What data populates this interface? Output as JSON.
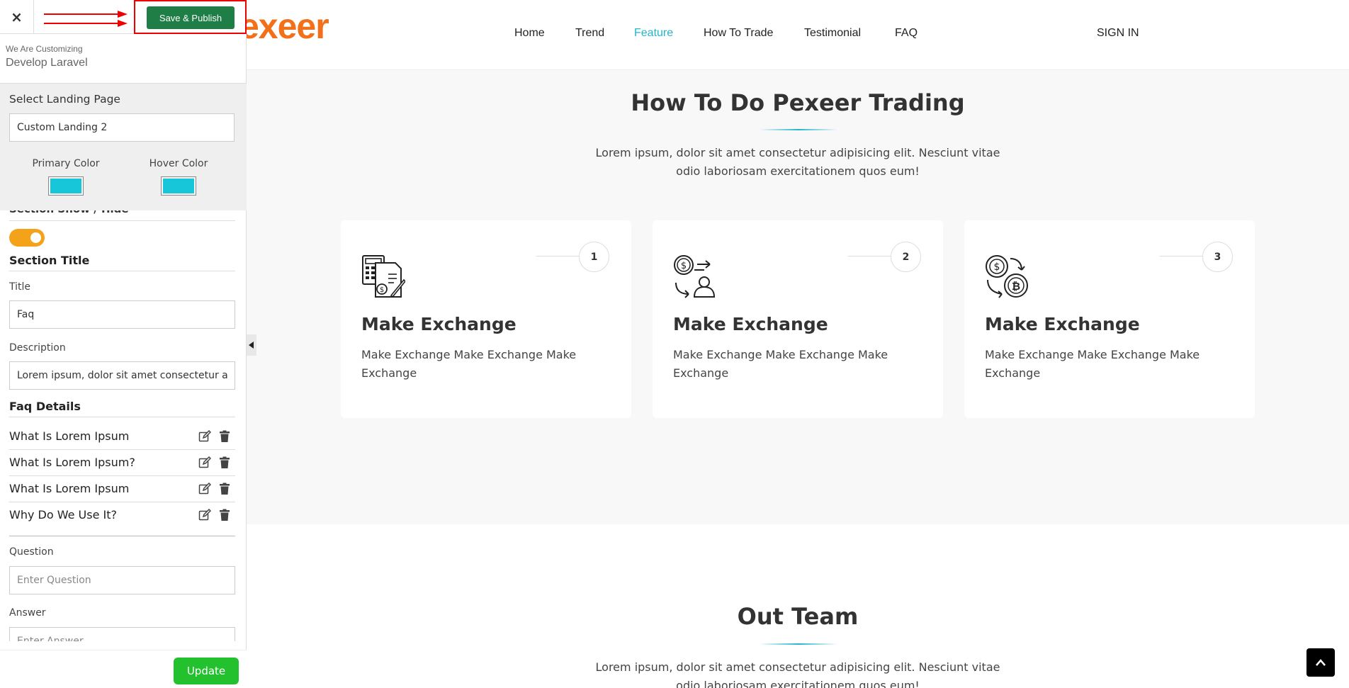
{
  "topbar": {
    "close_symbol": "×",
    "publish_label": "Save & Publish"
  },
  "customizing": {
    "small": "We Are Customizing",
    "name": "Develop Laravel"
  },
  "landing": {
    "label": "Select Landing Page",
    "value": "Custom Landing 2",
    "primary_color_label": "Primary Color",
    "hover_color_label": "Hover Color",
    "primary_color": "#17c6d8",
    "hover_color": "#17c6d8"
  },
  "section": {
    "show_hide_label": "Section Show / Hide",
    "toggle_on": true,
    "title_heading": "Section Title",
    "title_label": "Title",
    "title_value": "Faq",
    "description_label": "Description",
    "description_value": "Lorem ipsum, dolor sit amet consectetur adipisicing elit.",
    "faq_heading": "Faq Details",
    "faq_items": [
      "What Is Lorem Ipsum",
      "What Is Lorem Ipsum?",
      "What Is Lorem Ipsum",
      "Why Do We Use It?"
    ],
    "question_label": "Question",
    "question_placeholder": "Enter Question",
    "answer_label": "Answer",
    "answer_placeholder": "Enter Answer",
    "update_label": "Update"
  },
  "preview": {
    "logo_visible": "exeer",
    "nav": [
      "Home",
      "Trend",
      "Feature",
      "How To Trade",
      "Testimonial",
      "FAQ"
    ],
    "active_nav": "Feature",
    "signin": "SIGN IN",
    "accent_color": "#22b6cd",
    "logo_color": "#f3701a",
    "how_title": "How To Do Pexeer Trading",
    "how_desc": "Lorem ipsum, dolor sit amet consectetur adipisicing elit. Nesciunt vitae odio laboriosam exercitationem quos eum!",
    "cards": [
      {
        "num": "1",
        "title": "Make Exchange",
        "desc": "Make Exchange Make Exchange Make Exchange",
        "icon": "calculator-document-icon"
      },
      {
        "num": "2",
        "title": "Make Exchange",
        "desc": "Make Exchange Make Exchange Make Exchange",
        "icon": "dollar-user-exchange-icon"
      },
      {
        "num": "3",
        "title": "Make Exchange",
        "desc": "Make Exchange Make Exchange Make Exchange",
        "icon": "dollar-bitcoin-exchange-icon"
      }
    ],
    "team_title": "Out Team",
    "team_desc": "Lorem ipsum, dolor sit amet consectetur adipisicing elit. Nesciunt vitae odio laboriosam exercitationem quos eum!"
  }
}
